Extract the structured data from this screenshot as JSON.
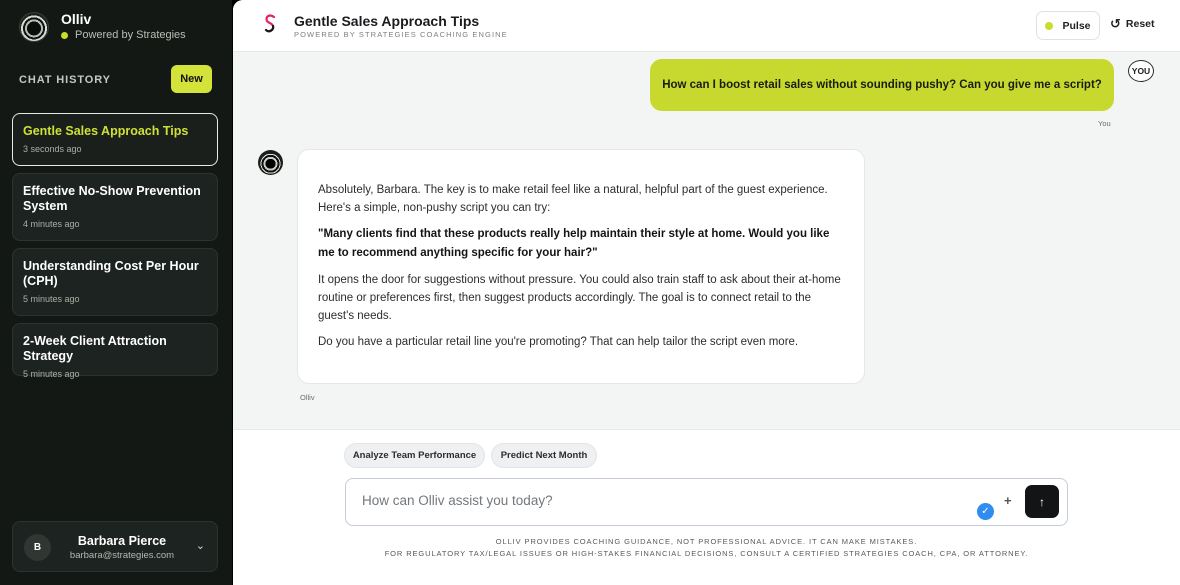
{
  "sidebar": {
    "brand_name": "Olliv",
    "brand_sub": "Powered by Strategies",
    "history_label": "CHAT HISTORY",
    "new_label": "New",
    "chats": [
      {
        "title": "Gentle Sales Approach Tips",
        "time": "3 seconds ago"
      },
      {
        "title": "Effective No-Show Prevention System",
        "time": "4 minutes ago"
      },
      {
        "title": "Understanding Cost Per Hour (CPH)",
        "time": "5 minutes ago"
      },
      {
        "title": "2-Week Client Attraction Strategy",
        "time": "5 minutes ago"
      }
    ],
    "user": {
      "initial": "B",
      "name": "Barbara Pierce",
      "email": "barbara@strategies.com"
    }
  },
  "header": {
    "title": "Gentle Sales Approach Tips",
    "subtitle": "POWERED BY STRATEGIES COACHING ENGINE",
    "pulse_label": "Pulse",
    "reset_label": "Reset"
  },
  "conversation": {
    "user_message": "How can I boost retail sales without sounding pushy? Can you give me a script?",
    "user_badge": "YOU",
    "user_label": "You",
    "bot_paragraphs": [
      "Absolutely, Barbara. The key is to make retail feel like a natural, helpful part of the guest experience. Here's a simple, non-pushy script you can try:",
      "\"Many clients find that these products really help maintain their style at home. Would you like me to recommend anything specific for your hair?\"",
      "It opens the door for suggestions without pressure. You could also train staff to ask about their at-home routine or preferences first, then suggest products accordingly. The goal is to connect retail to the guest's needs.",
      "Do you have a particular retail line you're promoting? That can help tailor the script even more."
    ],
    "bot_label": "Olliv"
  },
  "composer": {
    "chips": [
      "Analyze Team Performance",
      "Predict Next Month"
    ],
    "placeholder": "How can Olliv assist you today?",
    "disclaimer_1": "OLLIV PROVIDES COACHING GUIDANCE, NOT PROFESSIONAL ADVICE. IT CAN MAKE MISTAKES.",
    "disclaimer_2": "FOR REGULATORY TAX/LEGAL ISSUES OR HIGH-STAKES FINANCIAL DECISIONS, CONSULT A CERTIFIED STRATEGIES COACH, CPA, OR ATTORNEY."
  },
  "icons": {
    "brand": "olliv-logo-icon",
    "status_dot": "status-dot-icon",
    "chevron": "chevron-down-icon",
    "header_logo": "strategies-s-logo-icon",
    "reset": "reset-icon",
    "check": "check-badge-icon",
    "plus": "plus-icon",
    "send": "arrow-up-icon"
  },
  "colors": {
    "accent": "#c7d92e",
    "sidebar_bg": "#131815",
    "main_bg": "#f3f4f4",
    "send_bg": "#121416",
    "check_blue": "#2f8df0"
  }
}
